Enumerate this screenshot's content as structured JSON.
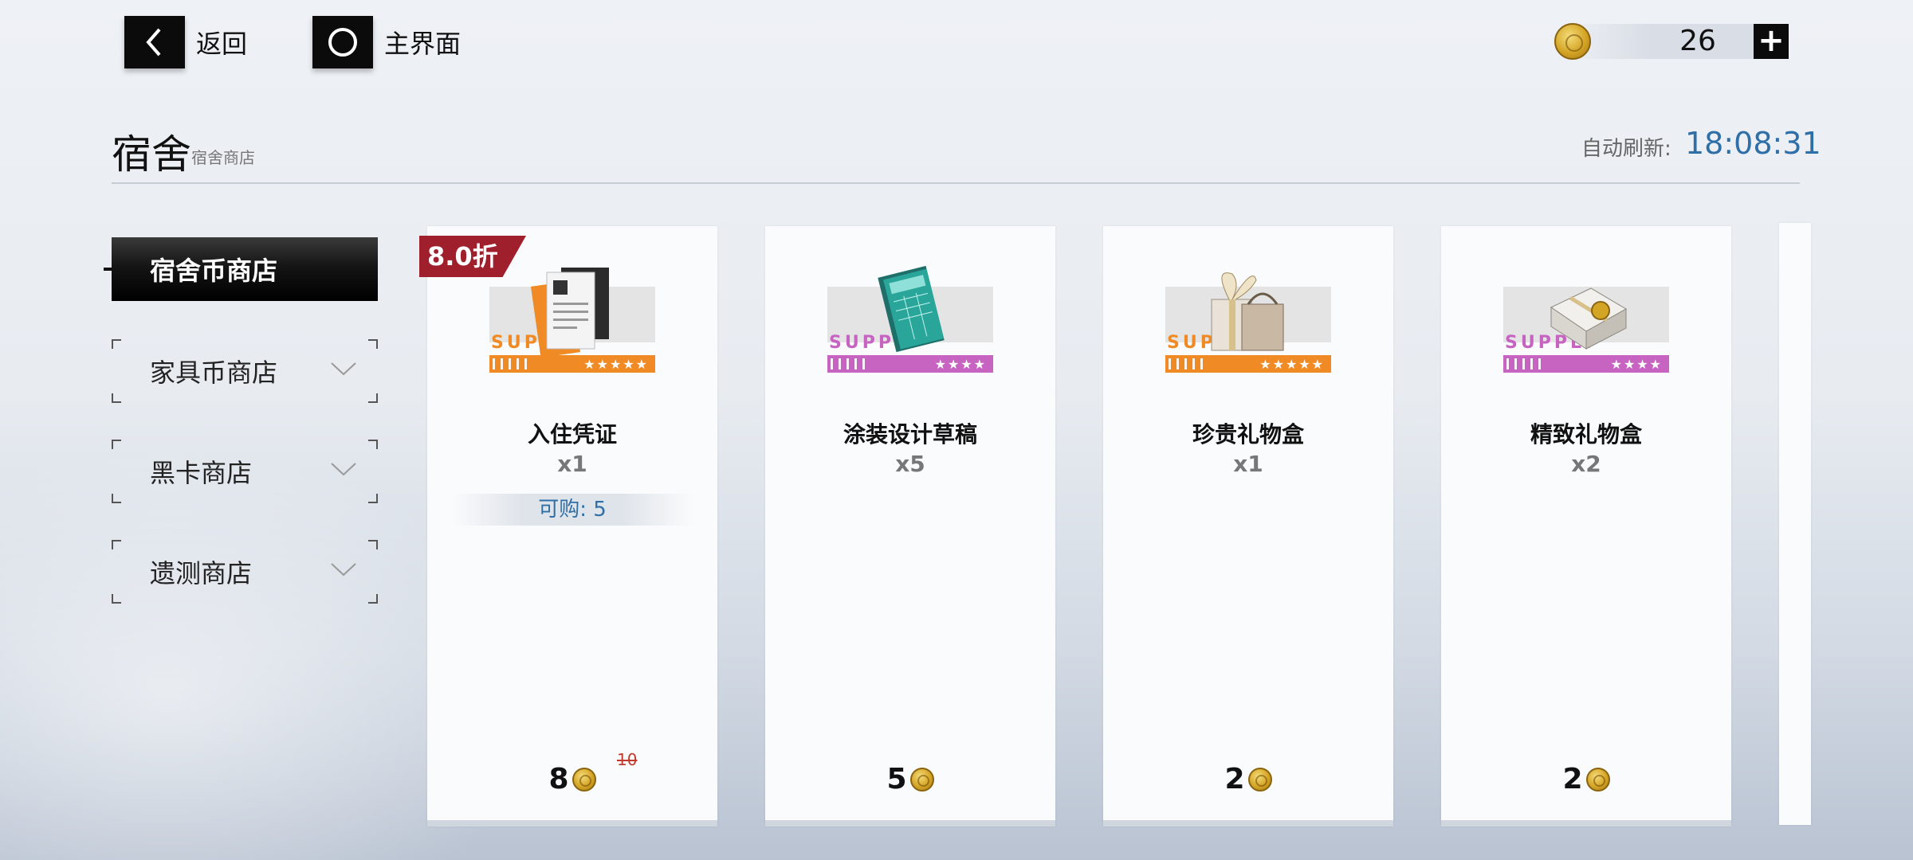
{
  "nav": {
    "back_label": "返回",
    "home_label": "主界面"
  },
  "currency": {
    "amount": "26",
    "icon": "gold-coin-icon",
    "add_icon": "plus-icon"
  },
  "header": {
    "title": "宿舍",
    "subtitle": "宿舍商店",
    "refresh_label": "自动刷新:",
    "refresh_time": "18:08:31"
  },
  "sidebar": {
    "items": [
      {
        "label": "宿舍币商店",
        "active": true
      },
      {
        "label": "家具币商店",
        "active": false
      },
      {
        "label": "黑卡商店",
        "active": false
      },
      {
        "label": "遗测商店",
        "active": false
      }
    ]
  },
  "cards": [
    {
      "discount": "8.0折",
      "supply": "SUPPLY",
      "stars": "★★★★★",
      "rarity_color": "#f08a24",
      "name": "入住凭证",
      "qty": "x1",
      "limit": "可购: 5",
      "price": "8",
      "old_price": "10"
    },
    {
      "supply": "SUPPLY",
      "stars": "★★★★",
      "rarity_color": "#c763c0",
      "name": "涂装设计草稿",
      "qty": "x5",
      "price": "5"
    },
    {
      "supply": "SUPPLY",
      "stars": "★★★★★",
      "rarity_color": "#f08a24",
      "name": "珍贵礼物盒",
      "qty": "x1",
      "price": "2"
    },
    {
      "supply": "SUPPLY",
      "stars": "★★★★",
      "rarity_color": "#c763c0",
      "name": "精致礼物盒",
      "qty": "x2",
      "price": "2"
    }
  ],
  "colors": {
    "accent_blue": "#2f6fa8",
    "discount_red": "#a01f2c"
  }
}
